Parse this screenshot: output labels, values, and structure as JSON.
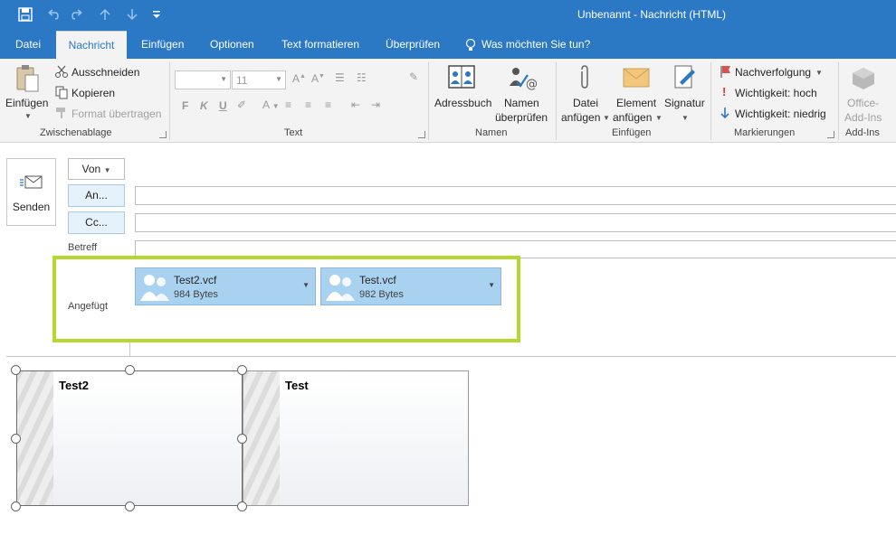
{
  "window": {
    "title": "Unbenannt - Nachricht (HTML)"
  },
  "qat": {
    "save_icon": "save-icon",
    "undo_icon": "undo-icon",
    "redo_icon": "redo-icon",
    "up_icon": "arrow-up-icon",
    "down_icon": "arrow-down-icon",
    "customize_icon": "customize-qat-icon"
  },
  "tabs": [
    {
      "label": "Datei"
    },
    {
      "label": "Nachricht"
    },
    {
      "label": "Einfügen"
    },
    {
      "label": "Optionen"
    },
    {
      "label": "Text formatieren"
    },
    {
      "label": "Überprüfen"
    }
  ],
  "tell_me": {
    "label": "Was möchten Sie tun?",
    "icon": "lightbulb-icon"
  },
  "ribbon": {
    "clipboard": {
      "paste": "Einfügen",
      "cut": "Ausschneiden",
      "copy": "Kopieren",
      "format_painter": "Format übertragen",
      "group": "Zwischenablage"
    },
    "text": {
      "font_size": "11",
      "bold": "F",
      "italic": "K",
      "underline": "U",
      "group": "Text"
    },
    "names": {
      "address_book": "Adressbuch",
      "check_names_1": "Namen",
      "check_names_2": "überprüfen",
      "group": "Namen"
    },
    "include": {
      "attach_file_1": "Datei",
      "attach_file_2": "anfügen",
      "attach_item_1": "Element",
      "attach_item_2": "anfügen",
      "signature": "Signatur",
      "group": "Einfügen"
    },
    "tags": {
      "follow_up": "Nachverfolgung",
      "high": "Wichtigkeit: hoch",
      "low": "Wichtigkeit: niedrig",
      "group": "Markierungen"
    },
    "addins": {
      "office_1": "Office-",
      "office_2": "Add-Ins",
      "group": "Add-Ins"
    }
  },
  "compose": {
    "send": "Senden",
    "from": "Von",
    "to": "An...",
    "cc": "Cc...",
    "subject_label": "Betreff",
    "attached_label": "Angefügt",
    "highlight_color": "#b4d82c"
  },
  "attachments": [
    {
      "name": "Test2.vcf",
      "size": "984 Bytes"
    },
    {
      "name": "Test.vcf",
      "size": "982 Bytes"
    }
  ],
  "body_cards": [
    {
      "name": "Test2"
    },
    {
      "name": "Test"
    }
  ]
}
